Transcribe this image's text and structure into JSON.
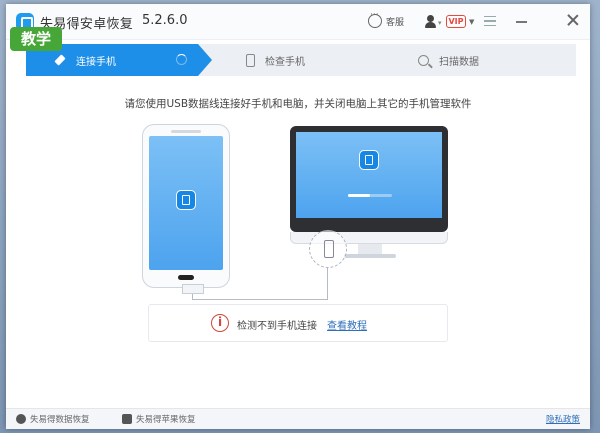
{
  "badge": "教学",
  "window": {
    "title": "失易得安卓恢复",
    "version": "5.2.6.0",
    "service_label": "客服",
    "vip_label": "VIP"
  },
  "steps": [
    {
      "label": "连接手机",
      "active": true
    },
    {
      "label": "检查手机",
      "active": false
    },
    {
      "label": "扫描数据",
      "active": false
    }
  ],
  "instruction": "请您使用USB数据线连接好手机和电脑，并关闭电脑上其它的手机管理软件",
  "status": {
    "message": "检测不到手机连接",
    "link": "查看教程"
  },
  "footer": {
    "items": [
      "失易得数据恢复",
      "失易得苹果恢复"
    ],
    "privacy": "隐私政策"
  },
  "colors": {
    "accent": "#1d8fe8",
    "badge": "#47a638",
    "alert": "#d2463c",
    "link": "#2f6fb8"
  },
  "icons": [
    "app-logo-icon",
    "customer-service-icon",
    "user-icon",
    "menu-icon",
    "minimize-icon",
    "close-icon",
    "plug-icon",
    "phone-icon",
    "search-icon",
    "alert-icon"
  ]
}
